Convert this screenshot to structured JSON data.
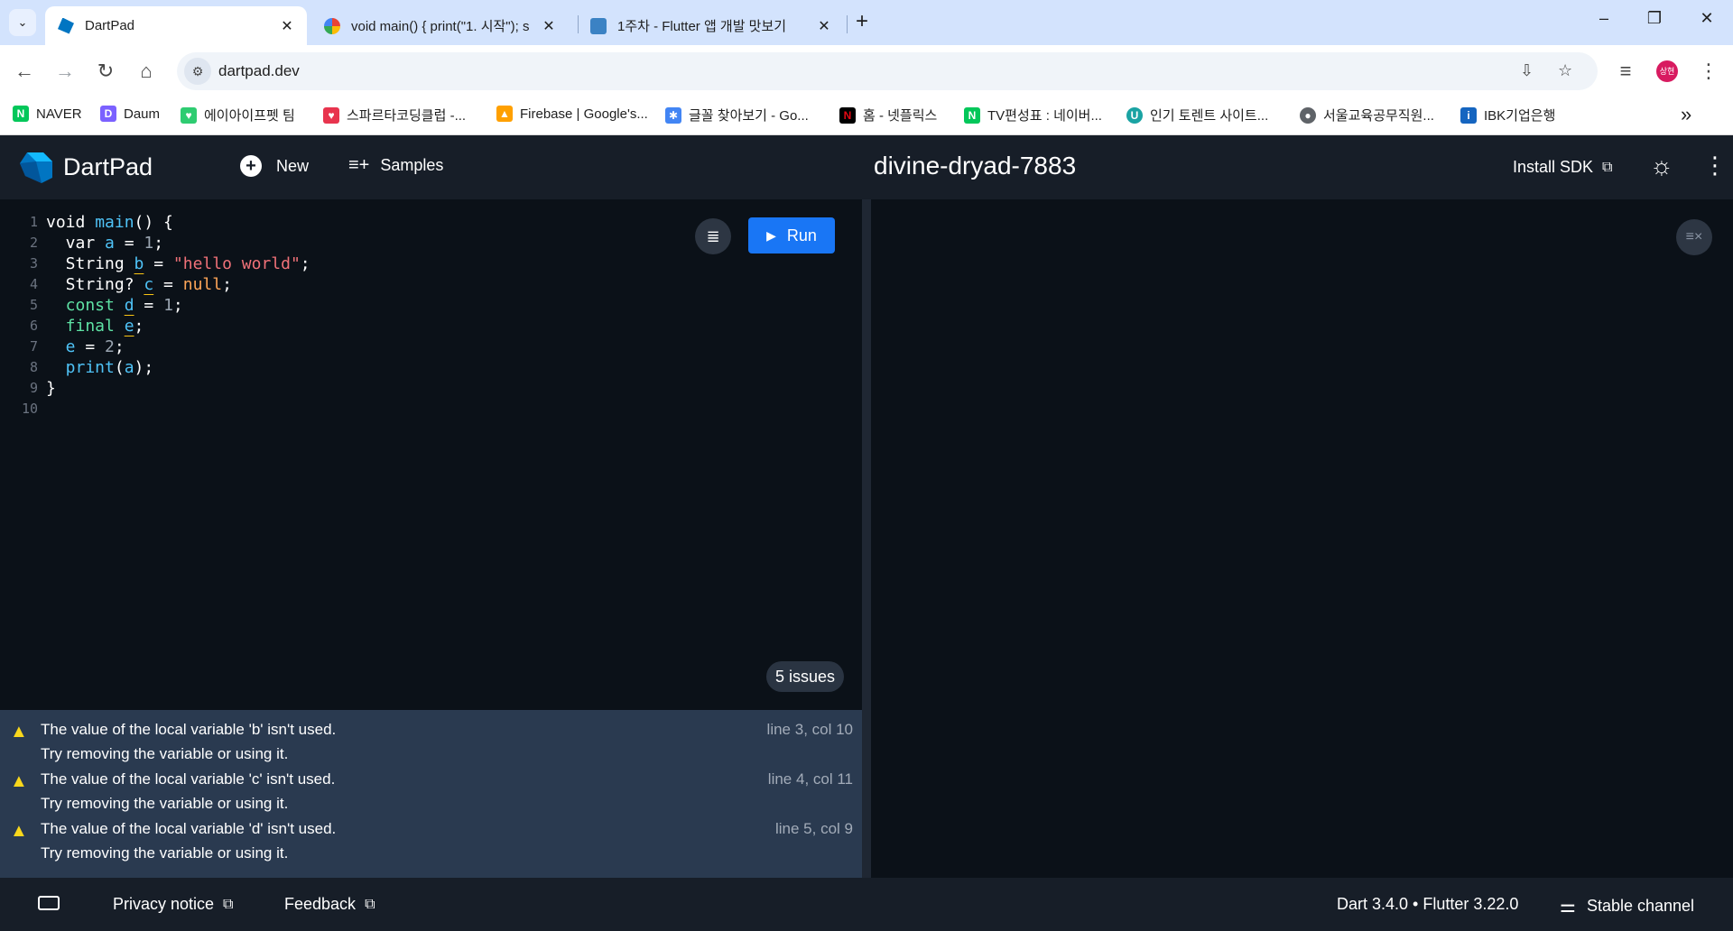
{
  "browser": {
    "tabs": [
      {
        "title": "DartPad",
        "close": "✕"
      },
      {
        "title": "void main() { print(\"1. 시작\"); s",
        "close": "✕"
      },
      {
        "title": "1주차 - Flutter 앱 개발 맛보기",
        "close": "✕"
      }
    ],
    "new_tab": "+",
    "url": "dartpad.dev",
    "avatar_text": "상현",
    "bookmarks": [
      {
        "label": "NAVER",
        "color": "#03c75a",
        "glyph": "N"
      },
      {
        "label": "Daum",
        "color": "#7b61ff",
        "glyph": "D"
      },
      {
        "label": "에이아이프펫 팀",
        "color": "#2ecc71",
        "glyph": "♥"
      },
      {
        "label": "스파르타코딩클럽 -...",
        "color": "#e8344e",
        "glyph": "♥"
      },
      {
        "label": "Firebase | Google's...",
        "color": "#ffa000",
        "glyph": "🔥"
      },
      {
        "label": "글꼴 찾아보기 - Go...",
        "color": "#4285f4",
        "glyph": "✱"
      },
      {
        "label": "홈 - 넷플릭스",
        "color": "#e50914",
        "glyph": "N"
      },
      {
        "label": "TV편성표 : 네이버...",
        "color": "#03c75a",
        "glyph": "N"
      },
      {
        "label": "인기 토렌트 사이트...",
        "color": "#1aa3a3",
        "glyph": "U"
      },
      {
        "label": "서울교육공무직원...",
        "color": "#5f6368",
        "glyph": "●"
      },
      {
        "label": "IBK기업은행",
        "color": "#1565c0",
        "glyph": "i"
      }
    ],
    "more_bookmarks": "»"
  },
  "header": {
    "app_title": "DartPad",
    "new_label": "New",
    "samples_label": "Samples",
    "snippet_name": "divine-dryad-7883",
    "install_label": "Install SDK"
  },
  "editor": {
    "line_numbers": [
      "1",
      "2",
      "3",
      "4",
      "5",
      "6",
      "7",
      "8",
      "9",
      "10"
    ],
    "run_label": "Run",
    "issues_badge": "5 issues"
  },
  "issues": [
    {
      "message": "The value of the local variable 'b' isn't used.",
      "fix": "Try removing the variable or using it.",
      "location": "line 3, col 10"
    },
    {
      "message": "The value of the local variable 'c' isn't used.",
      "fix": "Try removing the variable or using it.",
      "location": "line 4, col 11"
    },
    {
      "message": "The value of the local variable 'd' isn't used.",
      "fix": "Try removing the variable or using it.",
      "location": "line 5, col 9"
    }
  ],
  "footer": {
    "privacy_label": "Privacy notice",
    "feedback_label": "Feedback",
    "version_label": "Dart 3.4.0 • Flutter 3.22.0",
    "channel_label": "Stable channel"
  },
  "colors": {
    "accent": "#1976f5",
    "header_bg": "#171e28",
    "editor_bg": "#0b1118",
    "issues_bg": "#2a3a50",
    "warning": "#f9d71c"
  }
}
